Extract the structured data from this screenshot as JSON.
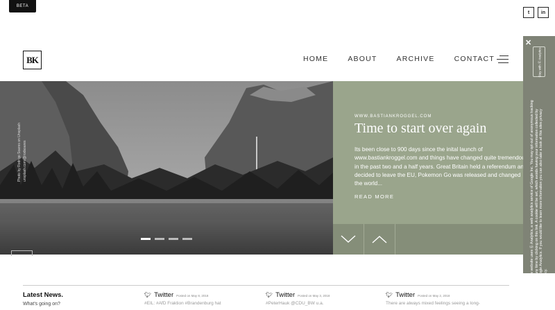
{
  "beta": {
    "label": "BETA"
  },
  "social": {
    "twitter": "t",
    "linkedin": "in"
  },
  "logo": {
    "text": "BK"
  },
  "nav": {
    "items": [
      "HOME",
      "ABOUT",
      "ARCHIVE",
      "CONTACT"
    ]
  },
  "hero": {
    "credit": [
      "Photo by Rodrigo Soares on Unsplash",
      "unsplash.com/@rodsoares"
    ],
    "slides_count": 4,
    "active_slide": 1
  },
  "post": {
    "kicker": "WWW.BASTIANKROGGEL.COM",
    "title": "Time to start over again",
    "excerpt": "Its been close to 900 days since the inital launch of www.bastiankroggel.com and things have changed quite tremendous in the past two and a half years. Great Britain held a referendum and decided to leave the EU, Pokemon Go was released and changed the world...",
    "read_more": "READ MORE"
  },
  "cookie": {
    "close": "✕",
    "optout": "Stay with Ⓖ Analytics",
    "text": "This website uses Ⓖ Analytics, a web analytics service of Google Inc. You may opt-out of anonymous tracking at any time by clicking on this link. A cookie will be set, which avoids having your information collected by Google Analytics. If you would like to learn more information you can also take a look at this sites privacy policy."
  },
  "footer": {
    "latest_title": "Latest News.",
    "latest_sub": "What's going on?",
    "tweets": [
      {
        "name": "Twitter",
        "date": "Posted on May 8, 2018",
        "text": "#EIL: #AfD Fraktion #Brandenburg hat"
      },
      {
        "name": "Twitter",
        "date": "Posted on May 3, 2018",
        "text": "#PeterHauk @CDU_BW u.a."
      },
      {
        "name": "Twitter",
        "date": "Posted on May 2, 2018",
        "text": "There are always mixed feelings seeing a long-"
      }
    ]
  },
  "colors": {
    "accent_green": "#9aa58c",
    "arrow_bar": "#858e79",
    "cookie_bg": "#7f8376"
  }
}
